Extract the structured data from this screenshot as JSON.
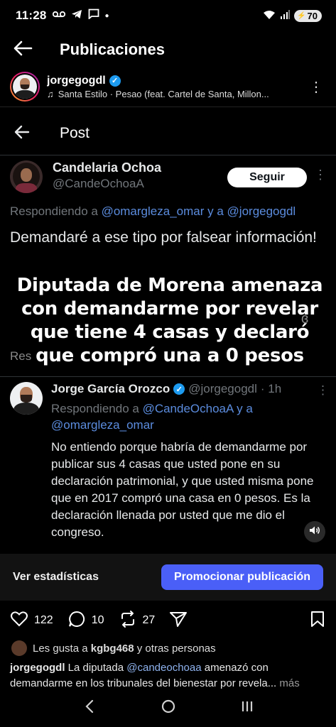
{
  "status_bar": {
    "time": "11:28",
    "left_icons": [
      "voicemail-icon",
      "telegram-icon",
      "message-icon",
      "dot-icon"
    ],
    "battery": "70"
  },
  "ig_header": {
    "title": "Publicaciones"
  },
  "ig_user": {
    "username": "jorgegogdl",
    "song": "Santa Estilo · Pesao (feat. Cartel de Santa, Millon..."
  },
  "post": {
    "header_title": "Post",
    "tweet1": {
      "name": "Candelaria Ochoa",
      "handle": "@CandeOchoaA",
      "follow_label": "Seguir",
      "replying_prefix": "Respondiendo a",
      "replying_user1": "@omargleza_omar",
      "replying_join": "y a",
      "replying_user2": "@jorgegogdl",
      "text": "Demandaré a ese tipo por falsear información!"
    },
    "caption_image": {
      "lines": [
        "Diputada de Morena amenaza",
        "con demandarme por revelar",
        "que tiene 4 casas y declaró",
        "que compró una a 0 pesos"
      ],
      "peek_left": "Res",
      "peek_right": "ɞ"
    },
    "tweet2": {
      "name": "Jorge García Orozco",
      "handle": "@jorgegogdl",
      "time": "· 1h",
      "replying_prefix": "Respondiendo a",
      "replying_user1": "@CandeOchoaA",
      "replying_join": "y a",
      "replying_user2": "@omargleza_omar",
      "text": "No entiendo porque habría de demandarme por publicar sus 4 casas que usted pone en su declaración patrimonial, y que usted misma pone que en 2017 compró una casa en 0 pesos. Es la declaración llenada por usted que me dio el congreso."
    }
  },
  "promo": {
    "stats_label": "Ver estadísticas",
    "promote_label": "Promocionar publicación",
    "accent": "#4a5ff7"
  },
  "actions": {
    "likes": "122",
    "comments": "10",
    "reposts": "27"
  },
  "likes_line": {
    "prefix": "Les gusta a",
    "user": "kgbg468",
    "suffix": "y otras personas"
  },
  "caption": {
    "user": "jorgegogdl",
    "text_before": "La diputada",
    "mention": "@candeochoaa",
    "text_after": "amenazó con demandarme en los tribunales del bienestar por revela...",
    "more": "más"
  },
  "navbar": {
    "items": [
      "back-nav-icon",
      "home-nav-icon",
      "recents-nav-icon"
    ]
  }
}
